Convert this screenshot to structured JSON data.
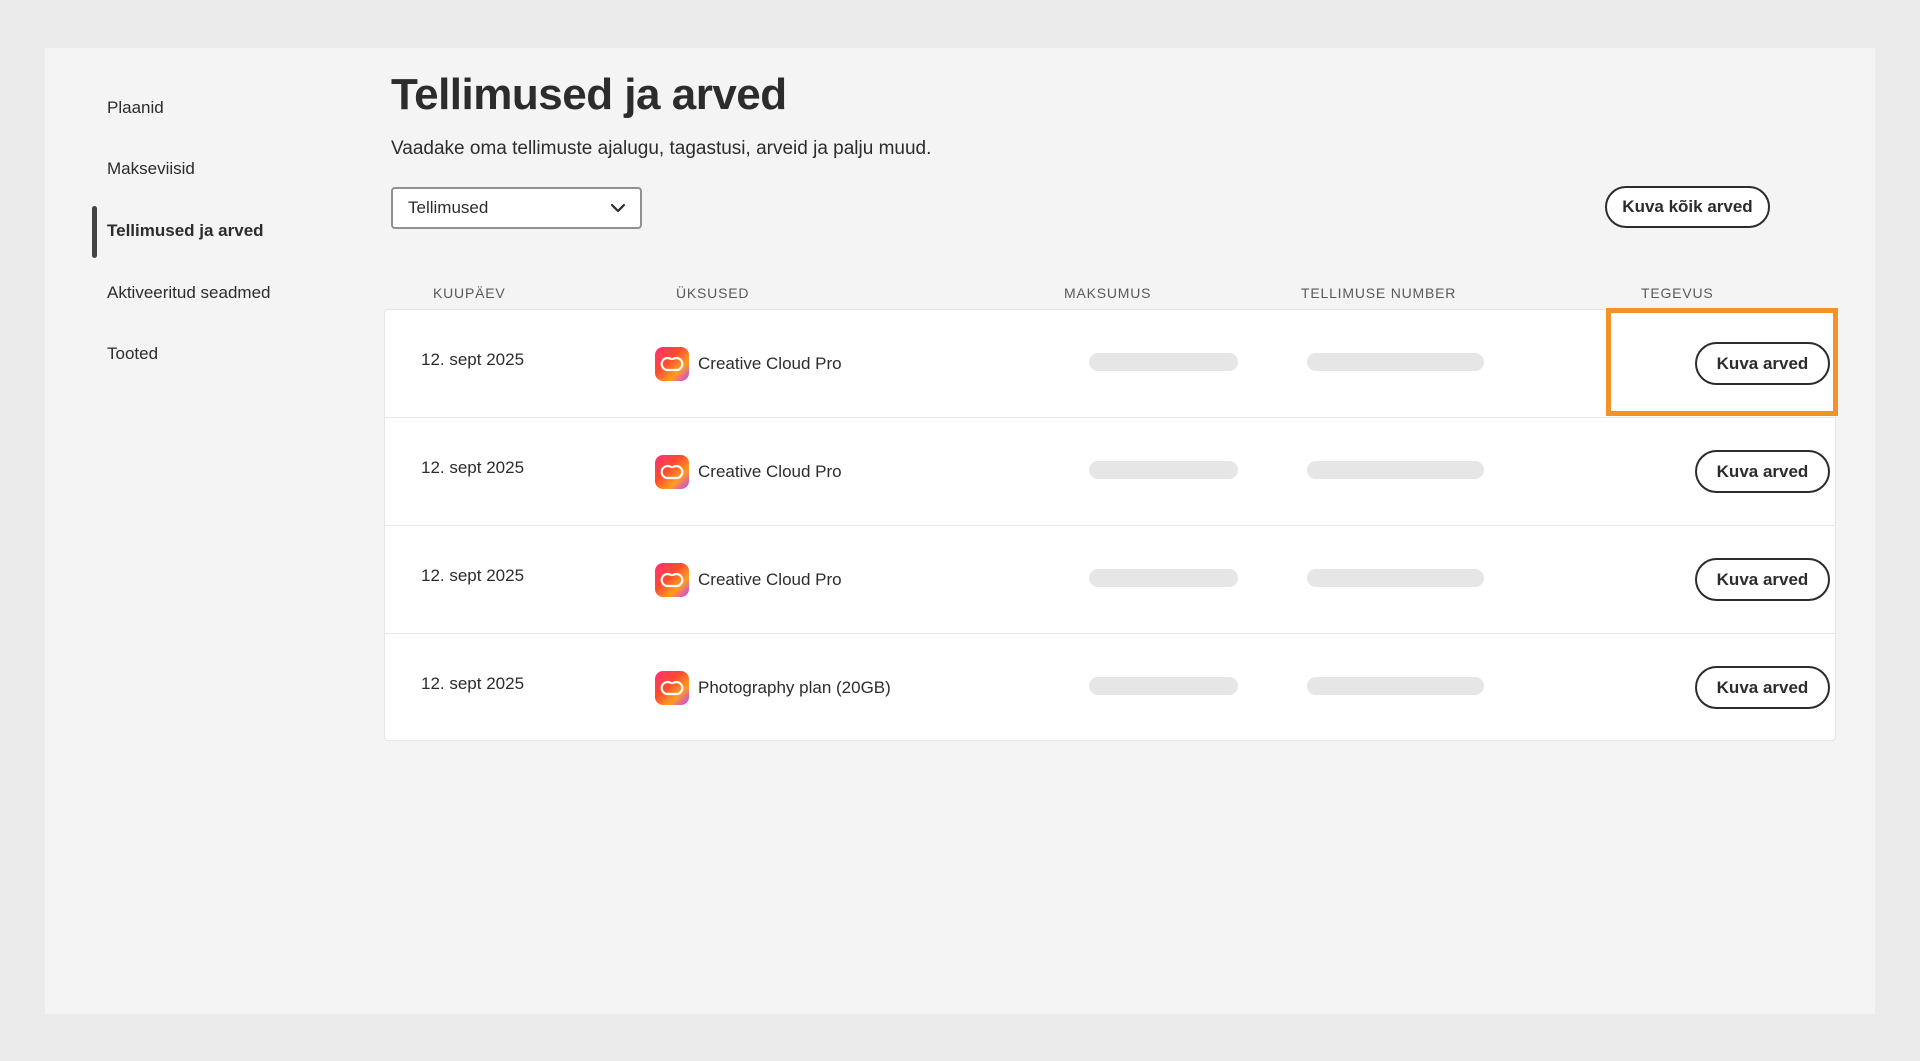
{
  "sidebar": {
    "items": [
      {
        "label": "Plaanid",
        "active": false
      },
      {
        "label": "Makseviisid",
        "active": false
      },
      {
        "label": "Tellimused ja arved",
        "active": true
      },
      {
        "label": "Aktiveeritud seadmed",
        "active": false
      },
      {
        "label": "Tooted",
        "active": false
      }
    ]
  },
  "header": {
    "title": "Tellimused ja arved",
    "subtitle": "Vaadake oma tellimuste ajalugu, tagastusi, arveid ja palju muud."
  },
  "filter": {
    "selected": "Tellimused",
    "icon": "chevron-down-icon"
  },
  "actions": {
    "view_all_invoices": "Kuva kõik arved"
  },
  "table": {
    "columns": [
      "KUUPÄEV",
      "ÜKSUSED",
      "MAKSUMUS",
      "TELLIMUSE NUMBER",
      "TEGEVUS"
    ],
    "rows": [
      {
        "date": "12. sept 2025",
        "item": "Creative Cloud Pro",
        "action": "Kuva arved"
      },
      {
        "date": "12. sept 2025",
        "item": "Creative Cloud Pro",
        "action": "Kuva arved"
      },
      {
        "date": "12. sept 2025",
        "item": "Creative Cloud Pro",
        "action": "Kuva arved"
      },
      {
        "date": "12. sept 2025",
        "item": "Photography plan (20GB)",
        "action": "Kuva arved"
      }
    ]
  },
  "colors": {
    "highlight": "#f39326",
    "text": "#2c2c2c",
    "panel": "#f4f4f4"
  }
}
